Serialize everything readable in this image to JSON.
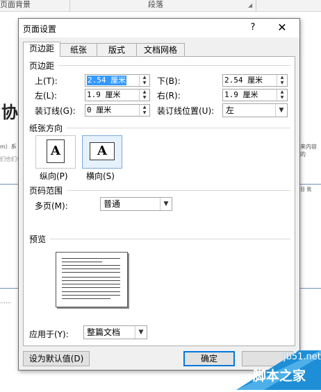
{
  "background_doc": {
    "ribbon_group_left": "页面背景",
    "ribbon_group_paragraph": "段落",
    "title_fragment": "协",
    "line1_fragment": "m）系",
    "line2_fragment": "们也们也",
    "right_fragment1": "来内容的",
    "right_fragment2": "目 我",
    "dots": "……",
    "rule_color": "#6f8fbf"
  },
  "dialog": {
    "title": "页面设置",
    "help_label": "?",
    "close_label": "✕",
    "tabs": [
      {
        "label": "页边距",
        "active": true
      },
      {
        "label": "纸张",
        "active": false
      },
      {
        "label": "版式",
        "active": false
      },
      {
        "label": "文档网格",
        "active": false
      }
    ],
    "margins": {
      "section_title": "页边距",
      "top": {
        "label": "上(T):",
        "value": "2.54 厘米"
      },
      "bottom": {
        "label": "下(B):",
        "value": "2.54 厘米"
      },
      "left": {
        "label": "左(L):",
        "value": "1.9 厘米"
      },
      "right": {
        "label": "右(R):",
        "value": "1.9 厘米"
      },
      "gutter": {
        "label": "装订线(G):",
        "value": "0 厘米"
      },
      "gutter_position": {
        "label": "装订线位置(U):",
        "value": "左"
      }
    },
    "orientation": {
      "section_title": "纸张方向",
      "portrait": {
        "label": "纵向(P)",
        "glyph": "A",
        "selected": false
      },
      "landscape": {
        "label": "横向(S)",
        "glyph": "A",
        "selected": true
      }
    },
    "pages": {
      "section_title": "页码范围",
      "multiple_label": "多页(M):",
      "multiple_value": "普通"
    },
    "preview": {
      "section_title": "预览"
    },
    "apply_to": {
      "label": "应用于(Y):",
      "value": "整篇文档"
    },
    "buttons": {
      "default": "设为默认值(D)",
      "ok": "确定"
    },
    "accent_color": "#0078d7",
    "selection_color": "#3399ff"
  },
  "watermark": {
    "site": "jb51.net",
    "name": "脚本之家",
    "color": "#1e8fd6"
  }
}
